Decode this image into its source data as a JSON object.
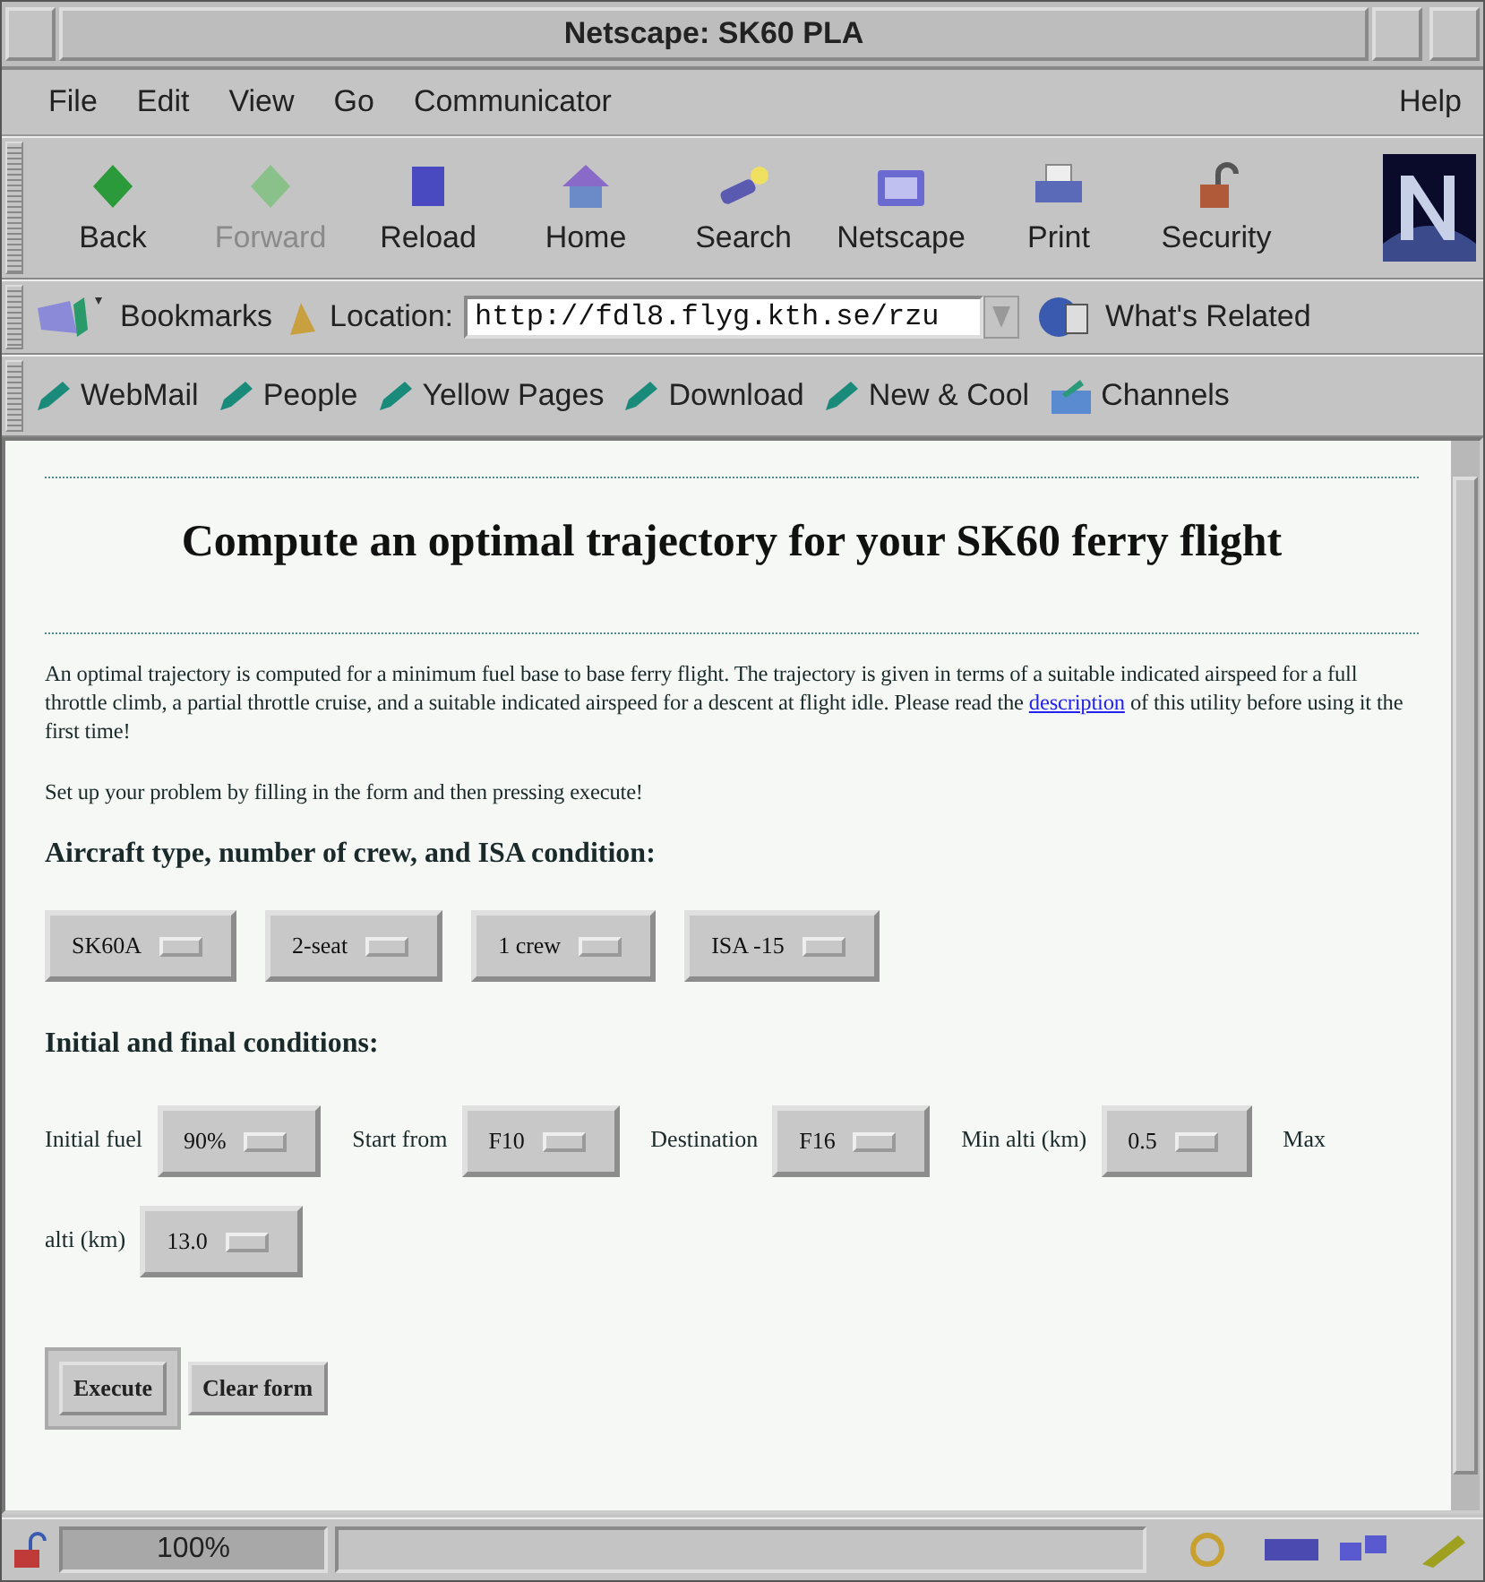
{
  "window": {
    "title": "Netscape: SK60 PLA"
  },
  "menu": {
    "items": [
      "File",
      "Edit",
      "View",
      "Go",
      "Communicator"
    ],
    "help": "Help"
  },
  "toolbar": [
    {
      "label": "Back",
      "disabled": false
    },
    {
      "label": "Forward",
      "disabled": true
    },
    {
      "label": "Reload",
      "disabled": false
    },
    {
      "label": "Home",
      "disabled": false
    },
    {
      "label": "Search",
      "disabled": false
    },
    {
      "label": "Netscape",
      "disabled": false
    },
    {
      "label": "Print",
      "disabled": false
    },
    {
      "label": "Security",
      "disabled": false
    }
  ],
  "location_bar": {
    "bookmarks": "Bookmarks",
    "label": "Location:",
    "url": "http://fdl8.flyg.kth.se/rzu",
    "related": "What's Related"
  },
  "personal_toolbar": [
    "WebMail",
    "People",
    "Yellow Pages",
    "Download",
    "New & Cool",
    "Channels"
  ],
  "page": {
    "heading": "Compute an optimal trajectory for your SK60 ferry flight",
    "intro_before": "An optimal trajectory is computed for a minimum fuel base to base ferry flight. The trajectory is given in terms of a suitable indicated airspeed for a full throttle climb, a partial throttle cruise, and a suitable indicated airspeed for a descent at flight idle. Please read the",
    "intro_link": "description",
    "intro_after": "of this utility before using it the first time!",
    "instruction": "Set up your problem by filling in the form and then pressing execute!",
    "section_1": "Aircraft type, number of crew, and ISA condition:",
    "aircraft_selects": [
      "SK60A",
      "2-seat",
      "1 crew",
      "ISA -15"
    ],
    "section_2": "Initial and final conditions:",
    "conditions": [
      {
        "label": "Initial fuel",
        "value": "90%"
      },
      {
        "label": "Start from",
        "value": "F10"
      },
      {
        "label": "Destination",
        "value": "F16"
      },
      {
        "label": "Min alti (km)",
        "value": "0.5"
      },
      {
        "label": "Max",
        "label_continued": "alti (km)",
        "value": "13.0"
      }
    ],
    "buttons": [
      {
        "label": "Execute",
        "default": true
      },
      {
        "label": "Clear form",
        "default": false
      }
    ]
  },
  "status_bar": {
    "progress": "100%"
  }
}
